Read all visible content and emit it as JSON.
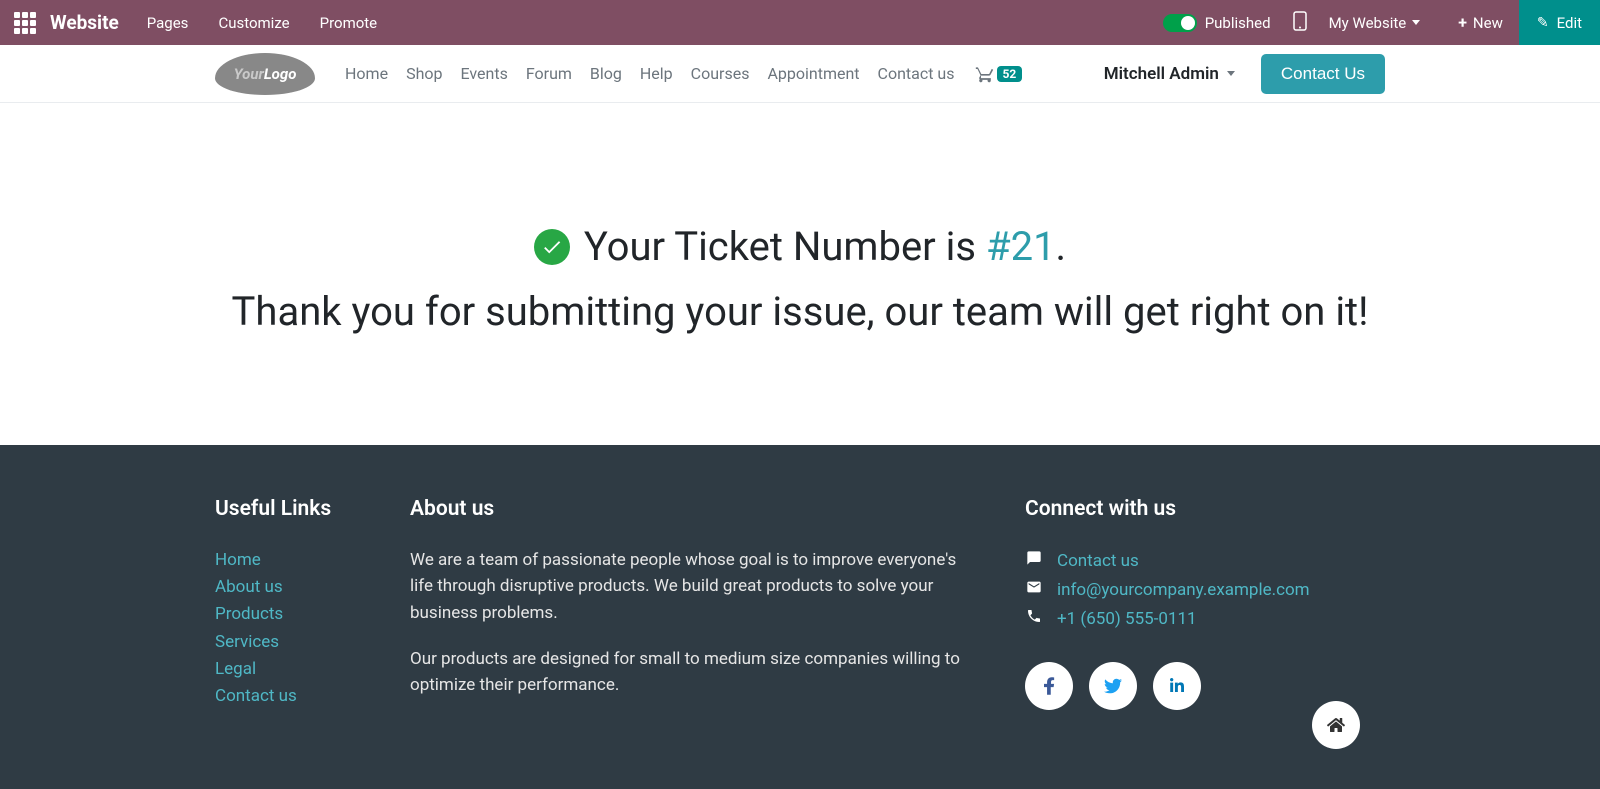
{
  "admin": {
    "app_name": "Website",
    "menu": [
      "Pages",
      "Customize",
      "Promote"
    ],
    "published_label": "Published",
    "my_website_label": "My Website",
    "new_label": "New",
    "edit_label": "Edit"
  },
  "nav": {
    "links": [
      "Home",
      "Shop",
      "Events",
      "Forum",
      "Blog",
      "Help",
      "Courses",
      "Appointment",
      "Contact us"
    ],
    "cart_count": "52",
    "user_name": "Mitchell Admin",
    "contact_btn": "Contact Us"
  },
  "main": {
    "ticket_prefix": "Your Ticket Number is ",
    "ticket_number": "#21",
    "ticket_suffix": ".",
    "thank_you": "Thank you for submitting your issue, our team will get right on it!"
  },
  "footer": {
    "useful_title": "Useful Links",
    "useful_links": [
      "Home",
      "About us",
      "Products",
      "Services",
      "Legal",
      "Contact us"
    ],
    "about_title": "About us",
    "about_p1": "We are a team of passionate people whose goal is to improve everyone's life through disruptive products. We build great products to solve your business problems.",
    "about_p2": "Our products are designed for small to medium size companies willing to optimize their performance.",
    "connect_title": "Connect with us",
    "contact_link": "Contact us",
    "email": "info@yourcompany.example.com",
    "phone": "+1 (650) 555-0111"
  }
}
